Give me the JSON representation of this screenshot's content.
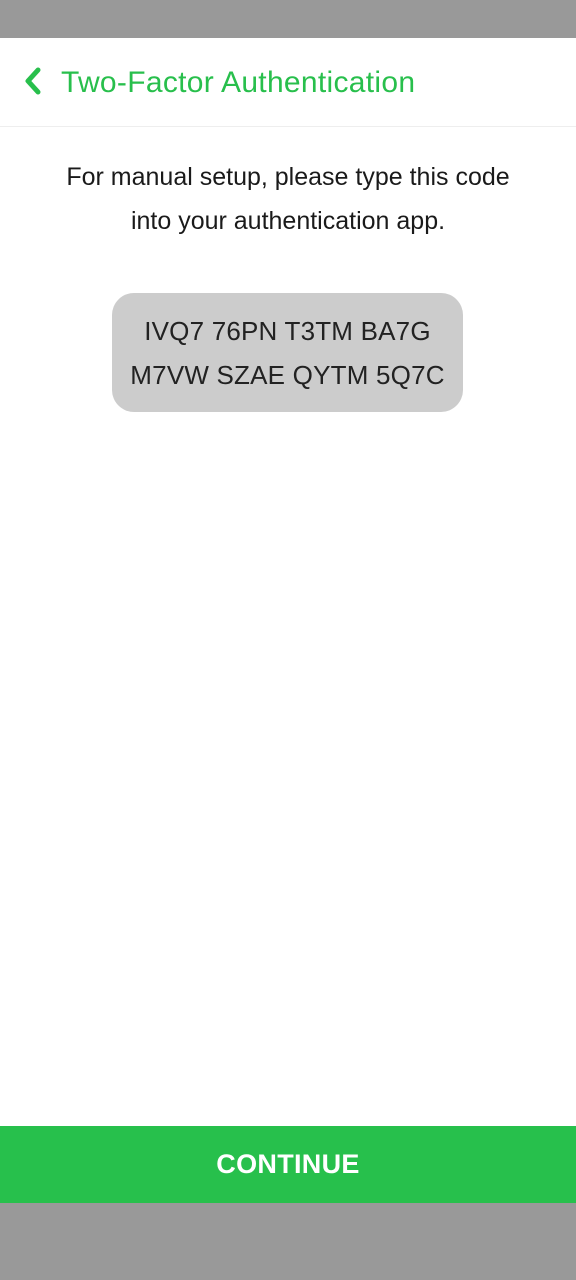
{
  "header": {
    "title": "Two-Factor Authentication",
    "back_icon": "chevron-left-icon"
  },
  "instructions": {
    "line1": "For manual setup, please type this code",
    "line2": "into your authentication app."
  },
  "code": {
    "line1": "IVQ7 76PN T3TM BA7G",
    "line2": "M7VW SZAE QYTM 5Q7C"
  },
  "continue_button": {
    "label": "CONTINUE"
  },
  "colors": {
    "accent": "#28bf4c",
    "code_box_bg": "#cccccc",
    "system_bars": "#999999"
  }
}
